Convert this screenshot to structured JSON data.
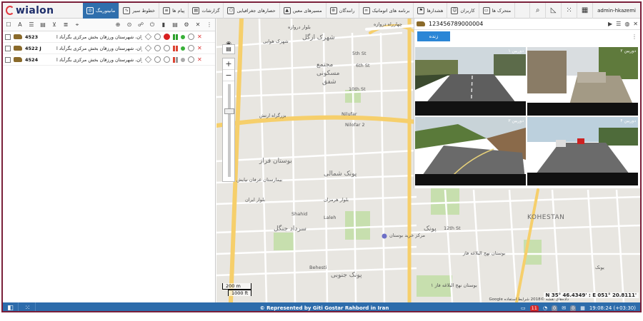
{
  "app": {
    "logo": "wialon"
  },
  "topbar": {
    "tabs": [
      {
        "label": "مانیتورینگ",
        "icon": "monitoring-icon",
        "active": true
      },
      {
        "label": "خطوط سیر",
        "icon": "tracks-icon"
      },
      {
        "label": "پیام ها",
        "icon": "messages-icon"
      },
      {
        "label": "گزارشات",
        "icon": "reports-icon"
      },
      {
        "label": "حصارهای جغرافیایی",
        "icon": "geofence-icon"
      },
      {
        "label": "مسیرهای معین",
        "icon": "routes-icon"
      },
      {
        "label": "رانندگان",
        "icon": "drivers-icon"
      },
      {
        "label": "برنامه های اتوماتیک",
        "icon": "jobs-icon"
      },
      {
        "label": "هشدارها",
        "icon": "notifications-icon"
      },
      {
        "label": "کاربران",
        "icon": "users-icon"
      },
      {
        "label": "متحرک ها",
        "icon": "units-icon"
      }
    ],
    "user": "admin-hkazemi"
  },
  "units": [
    {
      "name": "4523",
      "address": "ایران، تهران، شهرستان ورزقان بخش مرکزی بگرآباد ا..."
    },
    {
      "name": "4522 J",
      "address": "ایران، تهران، شهرستان ورزقان بخش مرکزی بگرآباد ا..."
    },
    {
      "name": "4524",
      "address": "ایران، تهران، شهرستان ورزقان بخش مرکزی بگرآباد ا..."
    }
  ],
  "map": {
    "labels": [
      "چهارراه دروازه",
      "بلوار دروازه",
      "شهرک ازگل",
      "شهرک هوایی",
      "مجتمع",
      "مسکونی",
      "شفق",
      "بزرگراه ارتش",
      "Nilufar",
      "بوستان فراز",
      "بیمارستان عرفان نیایش",
      "پونک شمالی",
      "مرکز خرید بوستان",
      "KOHESTAN",
      "پونک",
      "سرداد جنگل",
      "پونک جنوبی",
      "بوستان نهج البلاغه فاز",
      "بوستان نهج البلاغه فاز ۱",
      "یونک",
      "Laleh",
      "Behesti",
      "12th St",
      "10th St",
      "5th St",
      "6th St",
      "Nilofar 2",
      "Shahid",
      "بلوار هرمزان",
      "بلوار ایران"
    ],
    "scale_m": "200 m",
    "scale_ft": "1000 ft",
    "coords": "N 35° 46.4349' : E 051° 20.8111'",
    "credits": "Google  داده‌های نقشه ©2018  شرایط استفاده"
  },
  "video": {
    "device_id": "123456789000004",
    "live_label": "زنده",
    "channels": [
      "دوربین ۱",
      "دوربین ۲",
      "دوربین ۳",
      "دوربین ۴"
    ]
  },
  "bottombar": {
    "copyright": "© Represented by Giti Gostar Rahbord in Iran",
    "notifications_count": "11",
    "count_a": "0",
    "count_b": "0",
    "clock": "19:08:24 (+03:30)"
  }
}
